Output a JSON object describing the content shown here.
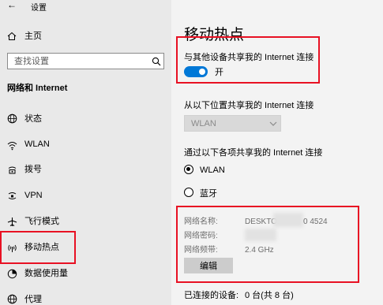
{
  "window": {
    "back_arrow": "←",
    "title": "设置"
  },
  "sidebar": {
    "home_label": "主页",
    "search_placeholder": "查找设置",
    "section_title": "网络和 Internet",
    "items": [
      {
        "label": "状态",
        "icon": "globe-status-icon"
      },
      {
        "label": "WLAN",
        "icon": "wifi-icon"
      },
      {
        "label": "拨号",
        "icon": "dialup-icon"
      },
      {
        "label": "VPN",
        "icon": "vpn-icon"
      },
      {
        "label": "飞行模式",
        "icon": "airplane-icon"
      },
      {
        "label": "移动热点",
        "icon": "hotspot-icon",
        "selected": true
      },
      {
        "label": "数据使用量",
        "icon": "data-usage-icon"
      },
      {
        "label": "代理",
        "icon": "globe-proxy-icon"
      }
    ]
  },
  "main": {
    "page_title": "移动热点",
    "share_label": "与其他设备共享我的 Internet 连接",
    "toggle_state": "开",
    "toggle_on": true,
    "share_from_label": "从以下位置共享我的 Internet 连接",
    "share_from_value": "WLAN",
    "share_over_label": "通过以下各项共享我的 Internet 连接",
    "radio_options": [
      {
        "label": "WLAN",
        "selected": true
      },
      {
        "label": "蓝牙",
        "selected": false
      }
    ],
    "network_name_label": "网络名称:",
    "network_name_value_start": "DESKTOI",
    "network_name_value_end": "0 4524",
    "network_password_label": "网络密码:",
    "network_band_label": "网络频带:",
    "network_band_value": "2.4 GHz",
    "edit_button": "编辑",
    "connected_label": "已连接的设备:",
    "connected_value": "0 台(共 8 台)"
  },
  "colors": {
    "accent": "#0078d7",
    "highlight": "#e81123",
    "sidebar_bg": "#e9e9e9",
    "main_bg": "#f3f3f3"
  }
}
